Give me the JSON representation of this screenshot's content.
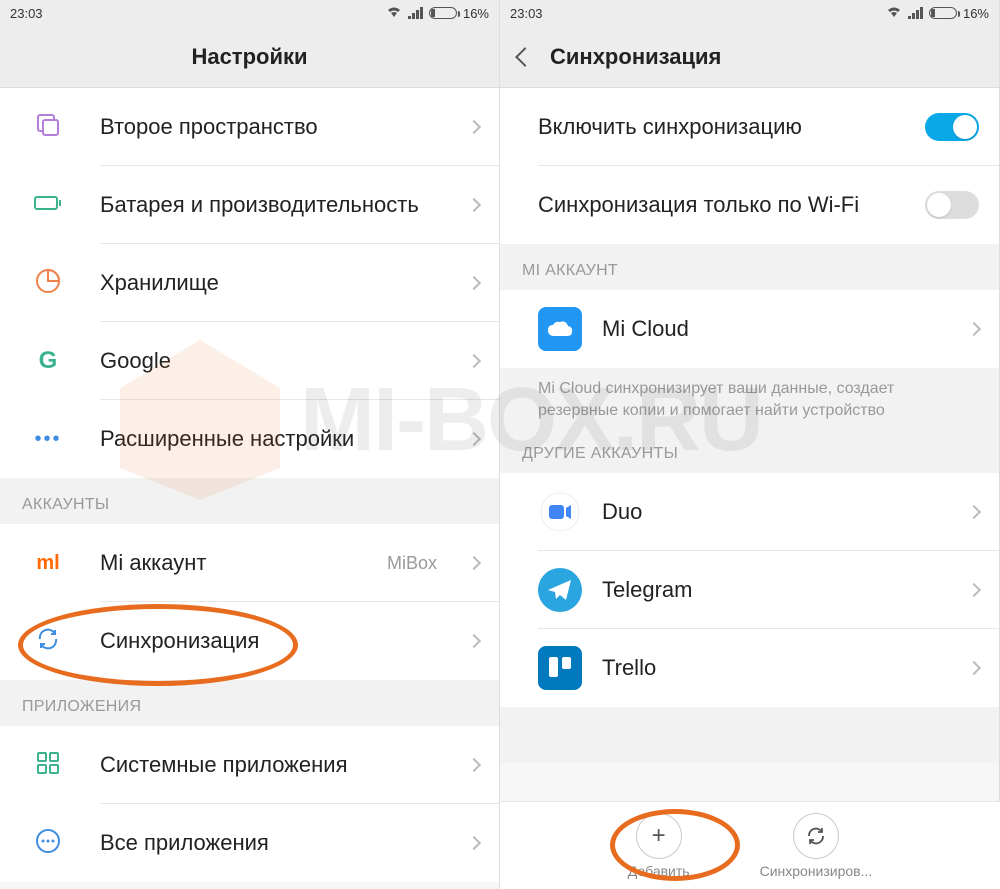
{
  "status": {
    "time": "23:03",
    "battery_pct": "16%"
  },
  "left": {
    "title": "Настройки",
    "items": [
      {
        "icon": "second-space",
        "label": "Второе пространство"
      },
      {
        "icon": "battery",
        "label": "Батарея и производительность"
      },
      {
        "icon": "storage",
        "label": "Хранилище"
      },
      {
        "icon": "google",
        "label": "Google"
      },
      {
        "icon": "more",
        "label": "Расширенные настройки"
      }
    ],
    "section_accounts": "АККАУНТЫ",
    "account_items": [
      {
        "icon": "mi",
        "label": "Mi аккаунт",
        "value": "MiBox"
      },
      {
        "icon": "sync",
        "label": "Синхронизация"
      }
    ],
    "section_apps": "ПРИЛОЖЕНИЯ",
    "app_items": [
      {
        "icon": "grid",
        "label": "Системные приложения"
      },
      {
        "icon": "dots",
        "label": "Все приложения"
      }
    ]
  },
  "right": {
    "title": "Синхронизация",
    "toggle_sync_label": "Включить синхронизацию",
    "toggle_wifi_label": "Синхронизация только по Wi-Fi",
    "section_mi": "MI АККАУНТ",
    "mi_cloud_label": "Mi Cloud",
    "mi_cloud_hint": "Mi Cloud синхронизирует ваши данные, создает резервные копии и помогает найти устройство",
    "section_other": "ДРУГИЕ АККАУНТЫ",
    "other_accounts": [
      {
        "icon": "duo",
        "label": "Duo",
        "color": "#4285f4"
      },
      {
        "icon": "telegram",
        "label": "Telegram",
        "color": "#2aa5e0"
      },
      {
        "icon": "trello",
        "label": "Trello",
        "color": "#0079bf"
      }
    ],
    "add_label": "Добавить",
    "sync_label": "Синхронизиров..."
  },
  "watermark_text": "MI-BOX.RU"
}
